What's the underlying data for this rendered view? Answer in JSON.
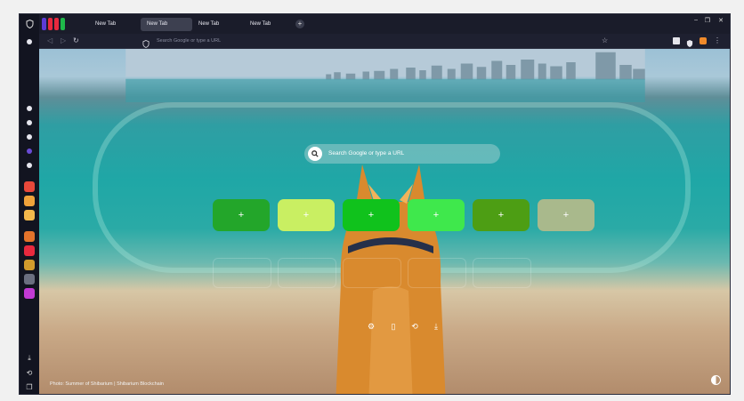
{
  "tabs": [
    {
      "label": "New Tab",
      "active": false
    },
    {
      "label": "New Tab",
      "active": true
    },
    {
      "label": "New Tab",
      "active": false
    },
    {
      "label": "New Tab",
      "active": false
    }
  ],
  "new_tab_symbol": "+",
  "window_controls": {
    "minimize": "–",
    "maximize": "❐",
    "close": "✕"
  },
  "toolbar": {
    "back": "◁",
    "forward": "▷",
    "reload": "↻",
    "url_placeholder": "Search Google or type a URL",
    "bookmark_star": "☆",
    "menu": "⋮"
  },
  "search": {
    "placeholder": "Search Google or type a URL"
  },
  "shortcuts": [
    {
      "label": "+",
      "color": "#23a62a"
    },
    {
      "label": "+",
      "color": "#c9ef62"
    },
    {
      "label": "+",
      "color": "#10c21c"
    },
    {
      "label": "+",
      "color": "#3fe84c"
    },
    {
      "label": "+",
      "color": "#4d9e14"
    },
    {
      "label": "+",
      "color": "#a9b98c"
    }
  ],
  "actions": [
    "⚙",
    "▯",
    "⟲",
    "⤓"
  ],
  "credit": "Photo: Summer of Shibarium | Shibarium Blockchain",
  "sidebar_colors": [
    "#e6e6ee",
    "#e6e6ee",
    "#e6e6ee",
    "#6a4bd6",
    "#e6e6ee",
    "#e8483a",
    "#f0a23a",
    "#f2b84b",
    "#e3732b",
    "#e8293e",
    "#d29b2c",
    "#6b6f80",
    "#c23ad4"
  ]
}
